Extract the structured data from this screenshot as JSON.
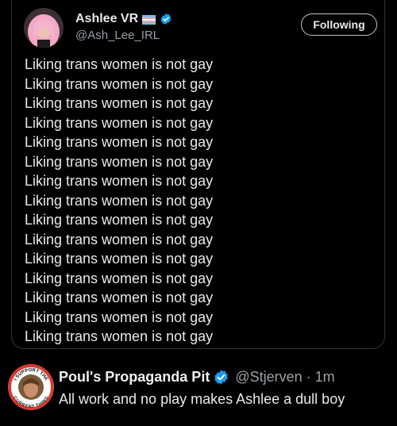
{
  "quoted_tweet": {
    "author": {
      "display_name": "Ashlee VR",
      "handle": "@Ash_Lee_IRL",
      "flag_icon": "trans-flag-icon",
      "verified_icon": "verified-badge-icon"
    },
    "follow_button_label": "Following",
    "lines": [
      "Liking trans women is not gay",
      "Liking trans women is not gay",
      "Liking trans women is not gay",
      "Liking trans women is not gay",
      "Liking trans women is not gay",
      "Liking trans women is not gay",
      "Liking trans women is not gay",
      "Liking trans women is not gay",
      "Liking trans women is not gay",
      "Liking trans women is not gay",
      "Liking trans women is not gay",
      "Liking trans women is not gay",
      "Liking trans women is not gay",
      "Liking trans women is not gay",
      "Liking trans women is not gay"
    ]
  },
  "reply": {
    "display_name": "Poul's Propaganda Pit",
    "handle": "@Stjerven",
    "separator": "·",
    "time": "1m",
    "text": "All work and no play makes Ashlee a dull boy",
    "avatar_badge_text_top": "I SUPPORT THE",
    "avatar_badge_text_bottom": "CURRENT THING"
  },
  "colors": {
    "background": "#000000",
    "text": "#e7e9ea",
    "secondary_text": "#9aa0a6",
    "verified_blue": "#1d9bf0",
    "border": "#2f3336"
  }
}
